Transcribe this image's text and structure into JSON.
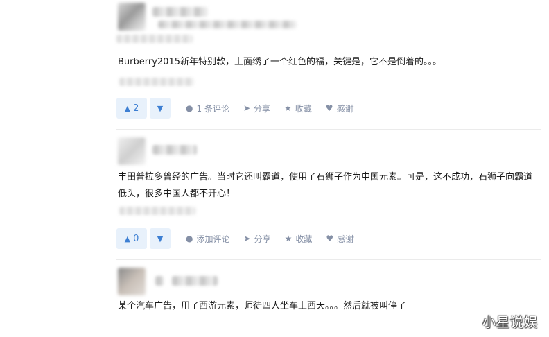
{
  "answers": [
    {
      "content": "Burberry2015新年特别款，上面绣了一个红色的福，关键是，它不是倒着的。。。",
      "upvotes": "2",
      "comment_label": "1 条评论",
      "share_label": "分享",
      "favorite_label": "收藏",
      "thanks_label": "感谢"
    },
    {
      "content": "丰田普拉多曾经的广告。当时它还叫霸道，使用了石狮子作为中国元素。可是，这不成功，石狮子向霸道低头，很多中国人都不开心！",
      "upvotes": "0",
      "comment_label": "添加评论",
      "share_label": "分享",
      "favorite_label": "收藏",
      "thanks_label": "感谢"
    },
    {
      "content": "某个汽车广告，用了西游元素，师徒四人坐车上西天。。。然后就被叫停了"
    }
  ],
  "icons": {
    "upvote": "triangle-up-icon",
    "downvote": "triangle-down-icon",
    "comment": "comment-bubble-icon",
    "share": "paper-plane-icon",
    "favorite": "star-icon",
    "thanks": "heart-icon"
  },
  "colors": {
    "vote_bg": "#e8f1fb",
    "vote_text": "#3d7fd3",
    "action_text": "#8590a6"
  },
  "watermark": "小星说娱"
}
